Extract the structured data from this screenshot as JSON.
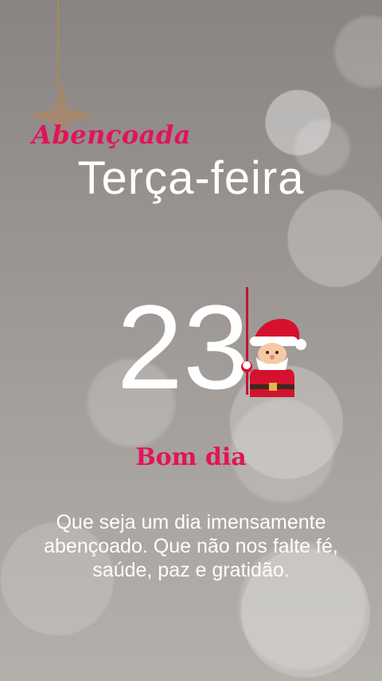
{
  "card": {
    "greeting_script": "Abençoada",
    "weekday": "Terça-feira",
    "day_number": "23",
    "good_morning": "Bom dia",
    "message": "Que seja um dia imensamente abençoado. Que não nos falte fé, saúde, paz e gratidão."
  },
  "colors": {
    "accent_pink": "#e0145a",
    "text_white": "#ffffff",
    "santa_red": "#c6122e"
  },
  "icons": [
    "star-ornament-icon",
    "santa-claus-icon"
  ]
}
